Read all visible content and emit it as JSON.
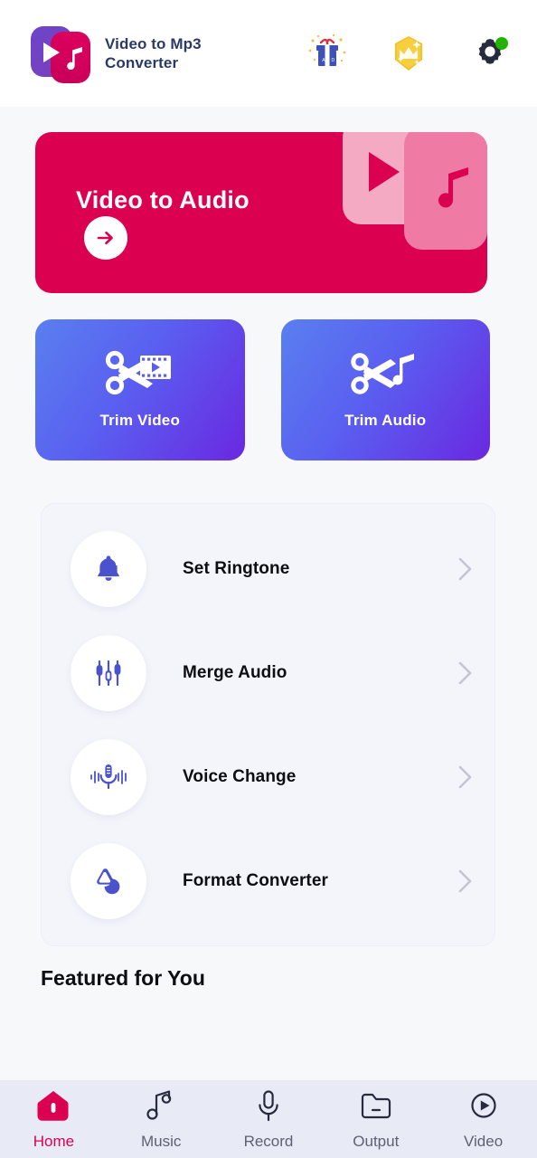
{
  "app": {
    "name_line1": "Video to Mp3",
    "name_line2": "Converter",
    "logo_icon": "video-music-logo",
    "brand_color": "#dc0050",
    "accent_blue": "#5a5ff0"
  },
  "header": {
    "actions": [
      {
        "name": "gift-ad-icon",
        "label": "AD",
        "color": "#3f51b5"
      },
      {
        "name": "premium-crown-icon",
        "label": "",
        "color": "#f5c518"
      },
      {
        "name": "settings-gear-icon",
        "label": "",
        "color": "#262b3e",
        "badge_color": "#21b300"
      }
    ]
  },
  "hero": {
    "title": "Video to Audio",
    "cta_icon": "arrow-right-icon",
    "background": "#dc0050"
  },
  "quick_actions": [
    {
      "label": "Trim Video",
      "icon": "scissors-film-icon"
    },
    {
      "label": "Trim Audio",
      "icon": "scissors-music-icon"
    }
  ],
  "tools": [
    {
      "label": "Set Ringtone",
      "icon": "bell-icon",
      "chevron": "chevron-right-icon"
    },
    {
      "label": "Merge Audio",
      "icon": "sliders-icon",
      "chevron": "chevron-right-icon"
    },
    {
      "label": "Voice Change",
      "icon": "microphone-waves-icon",
      "chevron": "chevron-right-icon"
    },
    {
      "label": "Format Converter",
      "icon": "format-convert-icon",
      "chevron": "chevron-right-icon"
    }
  ],
  "featured": {
    "title": "Featured for You"
  },
  "bottom_nav": {
    "active_index": 0,
    "items": [
      {
        "label": "Home",
        "icon": "home-icon"
      },
      {
        "label": "Music",
        "icon": "music-note-icon"
      },
      {
        "label": "Record",
        "icon": "microphone-icon"
      },
      {
        "label": "Output",
        "icon": "folder-icon"
      },
      {
        "label": "Video",
        "icon": "play-circle-icon"
      }
    ]
  }
}
